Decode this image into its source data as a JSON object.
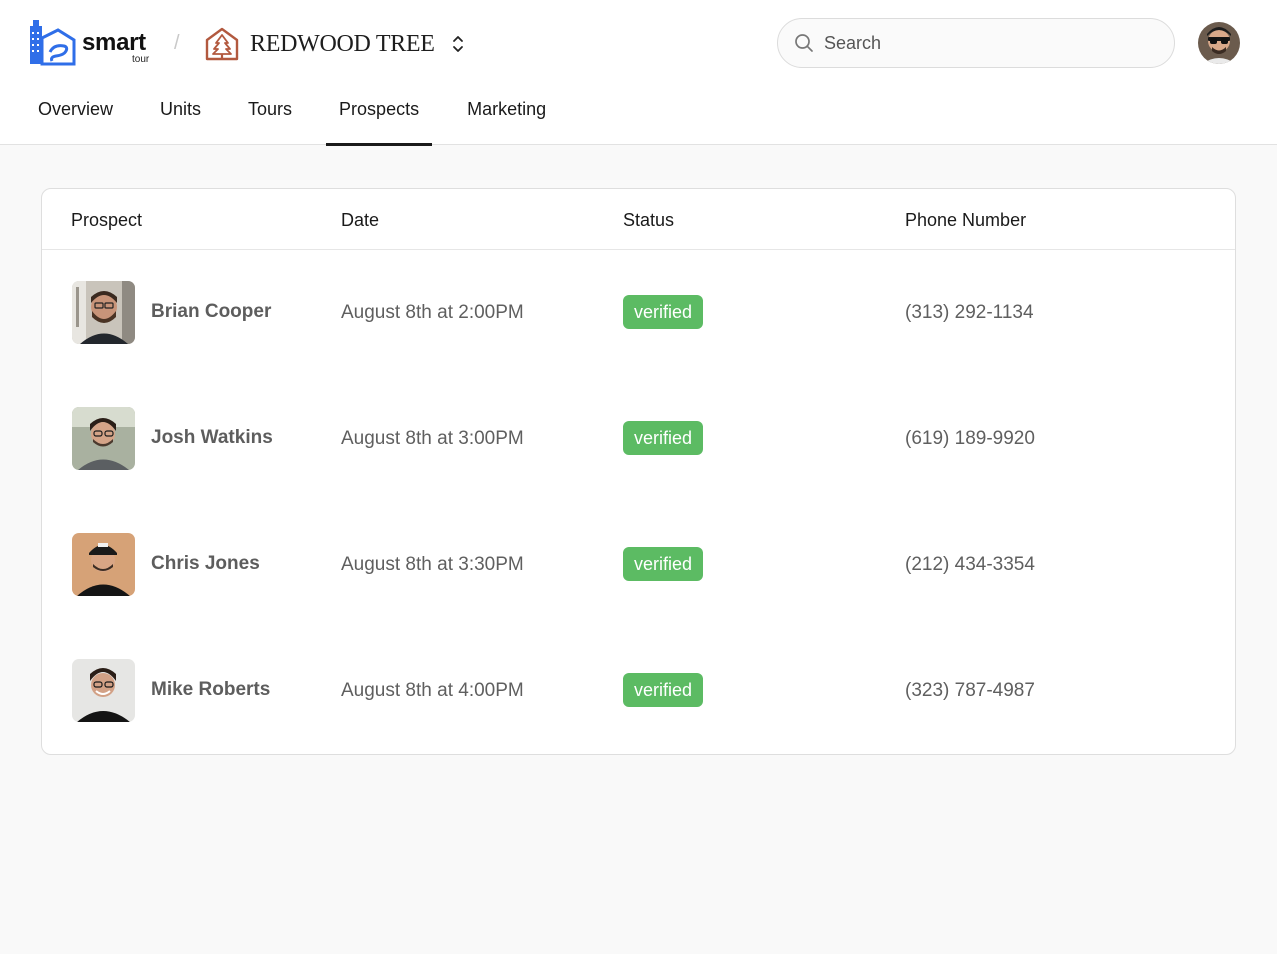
{
  "brand": {
    "name": "smart",
    "sub": "tour"
  },
  "org": {
    "name": "REDWOOD TREE"
  },
  "search": {
    "placeholder": "Search",
    "value": ""
  },
  "tabs": [
    {
      "label": "Overview",
      "active": false
    },
    {
      "label": "Units",
      "active": false
    },
    {
      "label": "Tours",
      "active": false
    },
    {
      "label": "Prospects",
      "active": true
    },
    {
      "label": "Marketing",
      "active": false
    }
  ],
  "table": {
    "headers": {
      "prospect": "Prospect",
      "date": "Date",
      "status": "Status",
      "phone": "Phone Number"
    },
    "rows": [
      {
        "name": "Brian Cooper",
        "date": "August 8th at 2:00PM",
        "status": "verified",
        "phone": "(313) 292-1134"
      },
      {
        "name": "Josh Watkins",
        "date": "August 8th at 3:00PM",
        "status": "verified",
        "phone": "(619) 189-9920"
      },
      {
        "name": "Chris Jones",
        "date": "August 8th at 3:30PM",
        "status": "verified",
        "phone": "(212) 434-3354"
      },
      {
        "name": "Mike Roberts",
        "date": "August 8th at 4:00PM",
        "status": "verified",
        "phone": "(323) 787-4987"
      }
    ]
  },
  "colors": {
    "accent_blue": "#2f6ee8",
    "redwood_brown": "#b2593f",
    "verified_green": "#5cbb63",
    "active_tab_underline": "#1a1a1a"
  },
  "icons": {
    "logo": "smart-tour-logo-icon",
    "org": "redwood-tree-icon",
    "switch": "chevron-up-down-icon",
    "search": "search-icon",
    "profile": "user-avatar"
  }
}
